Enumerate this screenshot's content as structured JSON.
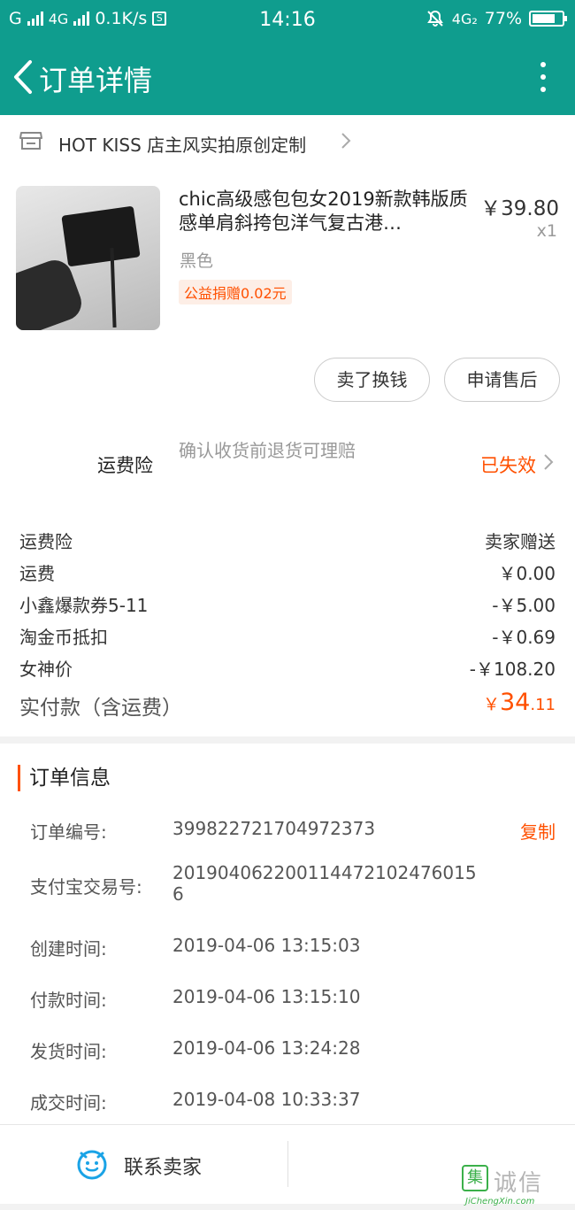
{
  "status_bar": {
    "carrier1": "G",
    "network": "4G",
    "speed": "0.1K/s",
    "app_icon": "S",
    "time": "14:16",
    "network2": "4G₂",
    "battery": "77%",
    "battery_level": 0.77
  },
  "navbar": {
    "title": "订单详情"
  },
  "shop": {
    "name": "HOT KISS 店主风实拍原创定制"
  },
  "item": {
    "title": "chic高级感包包女2019新款韩版质感单肩斜挎包洋气复古港…",
    "price": "￥39.80",
    "qty": "x1",
    "sku": "黑色",
    "charity": "公益捐赠0.02元",
    "sell_button": "卖了换钱",
    "after_sale_button": "申请售后"
  },
  "insurance": {
    "label": "运费险",
    "description": "确认收货前退货可理赔",
    "status": "已失效"
  },
  "fees": [
    {
      "label": "运费险",
      "value": "卖家赠送"
    },
    {
      "label": "运费",
      "value": "￥0.00"
    },
    {
      "label": "小鑫爆款券5-11",
      "value": "-￥5.00"
    },
    {
      "label": "淘金币抵扣",
      "value": "-￥0.69"
    },
    {
      "label": "女神价",
      "value": "-￥108.20"
    }
  ],
  "total": {
    "label": "实付款（含运费）",
    "currency": "￥",
    "integer": "34",
    "decimal": ".11"
  },
  "order_info": {
    "title": "订单信息",
    "copy_label": "复制",
    "rows": [
      {
        "label": "订单编号:",
        "value": "399822721704972373"
      },
      {
        "label": "支付宝交易号:",
        "value": "2019040622001144721024760156"
      },
      {
        "label": "创建时间:",
        "value": "2019-04-06 13:15:03"
      },
      {
        "label": "付款时间:",
        "value": "2019-04-06 13:15:10"
      },
      {
        "label": "发货时间:",
        "value": "2019-04-06 13:24:28"
      },
      {
        "label": "成交时间:",
        "value": "2019-04-08 10:33:37"
      }
    ]
  },
  "bottom_bar": {
    "contact_label": "联系卖家"
  },
  "watermark": {
    "mark": "集",
    "cn": "诚信",
    "en": "JiChengXin.com"
  }
}
